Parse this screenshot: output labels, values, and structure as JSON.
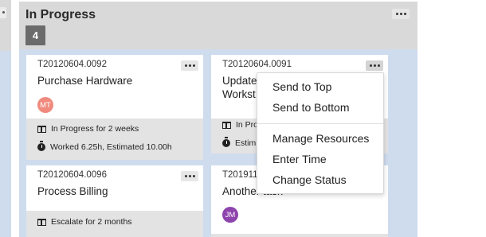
{
  "column": {
    "title": "In Progress",
    "count": "4"
  },
  "cards": [
    {
      "id": "T20120604.0092",
      "title": "Purchase Hardware",
      "avatar": {
        "initials": "MT",
        "color": "#f08a7e"
      },
      "status": "In Progress for 2 weeks",
      "time": "Worked 6.25h, Estimated 10.00h"
    },
    {
      "id": "T20120604.0091",
      "title_line1": "Update",
      "title_line2": "Workst",
      "status": "In Pro",
      "time": "Estim"
    },
    {
      "id": "T20120604.0096",
      "title": "Process Billing",
      "status": "Escalate for 2 months"
    },
    {
      "id": "T201911",
      "title": "Another task",
      "avatar": {
        "initials": "JM",
        "color": "#8e44ad"
      }
    }
  ],
  "context_menu": {
    "items": [
      "Send to Top",
      "Send to Bottom",
      "Manage Resources",
      "Enter Time",
      "Change Status"
    ]
  },
  "icons": {
    "more": "ellipsis-icon",
    "status": "board-icon",
    "time": "stopwatch-icon"
  }
}
